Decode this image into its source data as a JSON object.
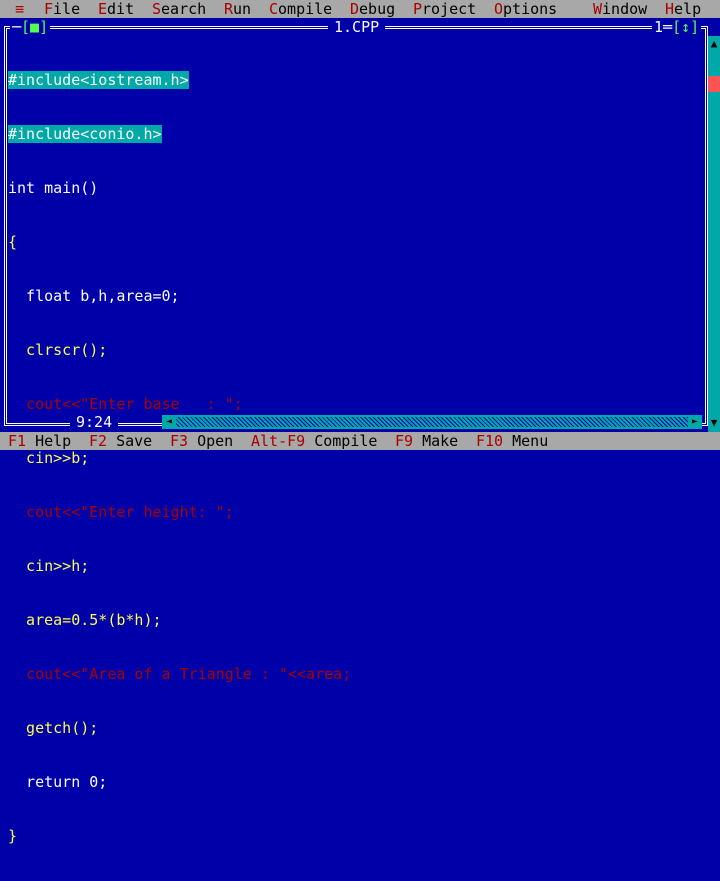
{
  "menu": [
    {
      "label": "≡",
      "hotkey": "",
      "rest": ""
    },
    {
      "label": "File",
      "hotkey": "F",
      "rest": "ile"
    },
    {
      "label": "Edit",
      "hotkey": "E",
      "rest": "dit"
    },
    {
      "label": "Search",
      "hotkey": "S",
      "rest": "earch"
    },
    {
      "label": "Run",
      "hotkey": "R",
      "rest": "un"
    },
    {
      "label": "Compile",
      "hotkey": "C",
      "rest": "ompile"
    },
    {
      "label": "Debug",
      "hotkey": "D",
      "rest": "ebug"
    },
    {
      "label": "Project",
      "hotkey": "P",
      "rest": "roject"
    },
    {
      "label": "Options",
      "hotkey": "O",
      "rest": "ptions"
    },
    {
      "label": "Window",
      "hotkey": "W",
      "rest": "indow"
    },
    {
      "label": "Help",
      "hotkey": "H",
      "rest": "elp"
    }
  ],
  "window": {
    "close_box": "[■]",
    "title": "1.CPP",
    "number": "1",
    "zoom_box": "[↕]",
    "cursor_position": "9:24"
  },
  "code_lines": [
    "#include<iostream.h>",
    "#include<conio.h>",
    "int main()",
    "{",
    "  float b,h,area=0;",
    "  clrscr();",
    "  cout<<\"Enter base   : \";",
    "  cin>>b;",
    "  cout<<\"Enter height: \";",
    "  cin>>h;",
    "  area=0.5*(b*h);",
    "  cout<<\"Area of a Triangle : \"<<area;",
    "  getch();",
    "  return 0;",
    "}"
  ],
  "statusbar": [
    {
      "key": "F1",
      "label": "Help"
    },
    {
      "key": "F2",
      "label": "Save"
    },
    {
      "key": "F3",
      "label": "Open"
    },
    {
      "key": "Alt-F9",
      "label": "Compile"
    },
    {
      "key": "F9",
      "label": "Make"
    },
    {
      "key": "F10",
      "label": "Menu"
    }
  ],
  "icons": {
    "scroll_up": "scroll-up-icon",
    "scroll_down": "scroll-down-icon",
    "scroll_left": "scroll-left-icon",
    "scroll_right": "scroll-right-icon"
  },
  "colors": {
    "background": "#0000a8",
    "menubar": "#a8a8a8",
    "hotkey": "#a80000",
    "string": "#a80000",
    "identifier": "#fcfc54",
    "keyword": "#fcfcfc",
    "scrollbar": "#00a8a8",
    "selection": "#00a8a8"
  }
}
